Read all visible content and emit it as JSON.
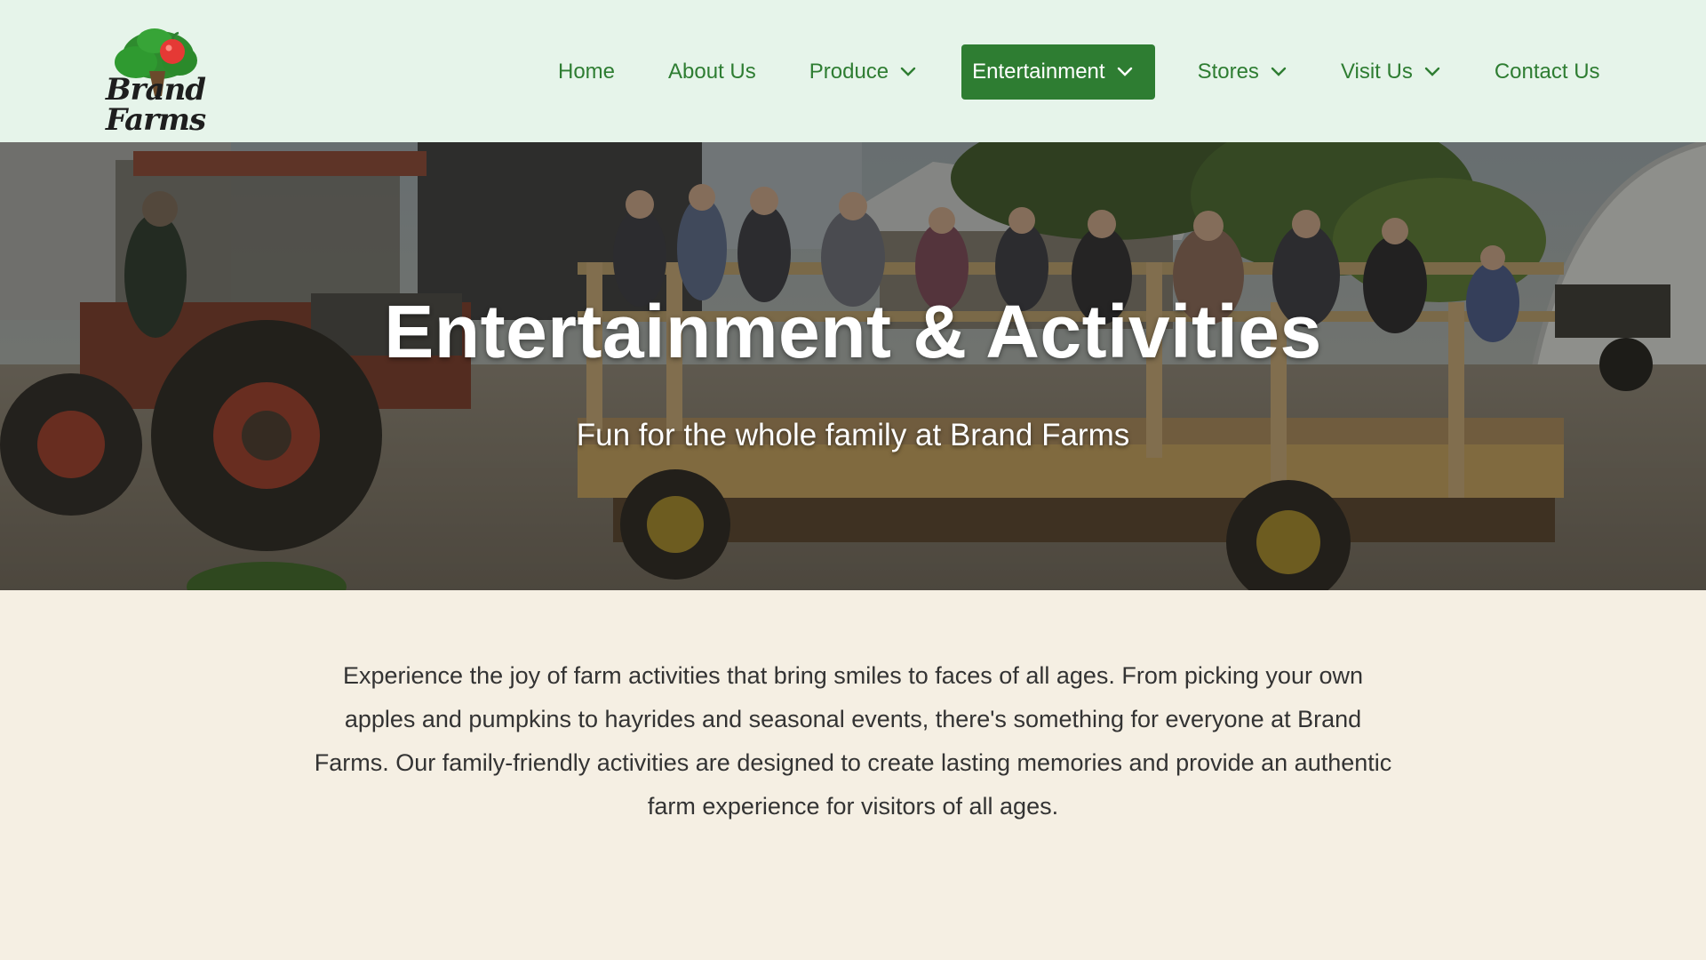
{
  "brand": {
    "name": "Brand Farms",
    "logo_icon": "apple-tree-icon",
    "colors": {
      "primary_green": "#2e7d32",
      "header_bg": "#e6f4ea",
      "page_bg": "#f5efe3",
      "apple_red": "#e53935"
    }
  },
  "nav": {
    "items": [
      {
        "label": "Home",
        "dropdown": false
      },
      {
        "label": "About Us",
        "dropdown": false
      },
      {
        "label": "Produce",
        "dropdown": true
      },
      {
        "label": "Entertainment",
        "dropdown": true,
        "active": true
      },
      {
        "label": "Stores",
        "dropdown": true
      },
      {
        "label": "Visit Us",
        "dropdown": true
      },
      {
        "label": "Contact Us",
        "dropdown": false
      }
    ]
  },
  "hero": {
    "title": "Entertainment & Activities",
    "subtitle": "Fun for the whole family at Brand Farms",
    "image": "tractor pulling a hay wagon full of visitors"
  },
  "intro": {
    "text": "Experience the joy of farm activities that bring smiles to faces of all ages. From picking your own apples and pumpkins to hayrides and seasonal events, there's something for everyone at Brand Farms. Our family-friendly activities are designed to create lasting memories and provide an authentic farm experience for visitors of all ages."
  }
}
